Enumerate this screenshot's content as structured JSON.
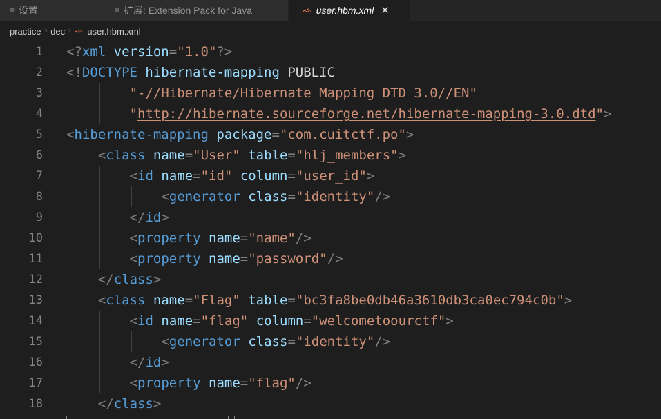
{
  "tabs": [
    {
      "icon": "≡",
      "label": "设置"
    },
    {
      "icon": "≡",
      "label": "扩展: Extension Pack for Java"
    },
    {
      "icon": "⁠ᨒ",
      "label": "user.hbm.xml",
      "close": "✕"
    }
  ],
  "breadcrumb": {
    "parts": [
      "practice",
      "dec",
      "user.hbm.xml"
    ],
    "separator": "›"
  },
  "lines": [
    {
      "n": "1",
      "indent": 0,
      "tokens": [
        [
          "p",
          "<?"
        ],
        [
          "tag",
          "xml"
        ],
        [
          "text",
          " "
        ],
        [
          "attr",
          "version"
        ],
        [
          "p",
          "="
        ],
        [
          "str",
          "\"1.0\""
        ],
        [
          "p",
          "?>"
        ]
      ]
    },
    {
      "n": "2",
      "indent": 0,
      "tokens": [
        [
          "p",
          "<!"
        ],
        [
          "tag",
          "DOCTYPE"
        ],
        [
          "text",
          " "
        ],
        [
          "attr",
          "hibernate-mapping"
        ],
        [
          "text",
          " PUBLIC"
        ]
      ]
    },
    {
      "n": "3",
      "indent": 8,
      "tokens": [
        [
          "str",
          "\"-//Hibernate/Hibernate Mapping DTD 3.0//EN\""
        ]
      ]
    },
    {
      "n": "4",
      "indent": 8,
      "tokens": [
        [
          "str",
          "\""
        ],
        [
          "url",
          "http://hibernate.sourceforge.net/hibernate-mapping-3.0.dtd"
        ],
        [
          "str",
          "\""
        ],
        [
          "p",
          ">"
        ]
      ]
    },
    {
      "n": "5",
      "indent": 0,
      "tokens": [
        [
          "p",
          "<"
        ],
        [
          "tag",
          "hibernate-mapping"
        ],
        [
          "text",
          " "
        ],
        [
          "attr",
          "package"
        ],
        [
          "p",
          "="
        ],
        [
          "str",
          "\"com.cuitctf.po\""
        ],
        [
          "p",
          ">"
        ]
      ]
    },
    {
      "n": "6",
      "indent": 4,
      "tokens": [
        [
          "p",
          "<"
        ],
        [
          "tag",
          "class"
        ],
        [
          "text",
          " "
        ],
        [
          "attr",
          "name"
        ],
        [
          "p",
          "="
        ],
        [
          "str",
          "\"User\""
        ],
        [
          "text",
          " "
        ],
        [
          "attr",
          "table"
        ],
        [
          "p",
          "="
        ],
        [
          "str",
          "\"hlj_members\""
        ],
        [
          "p",
          ">"
        ]
      ]
    },
    {
      "n": "7",
      "indent": 8,
      "tokens": [
        [
          "p",
          "<"
        ],
        [
          "tag",
          "id"
        ],
        [
          "text",
          " "
        ],
        [
          "attr",
          "name"
        ],
        [
          "p",
          "="
        ],
        [
          "str",
          "\"id\""
        ],
        [
          "text",
          " "
        ],
        [
          "attr",
          "column"
        ],
        [
          "p",
          "="
        ],
        [
          "str",
          "\"user_id\""
        ],
        [
          "p",
          ">"
        ]
      ]
    },
    {
      "n": "8",
      "indent": 12,
      "tokens": [
        [
          "p",
          "<"
        ],
        [
          "tag",
          "generator"
        ],
        [
          "text",
          " "
        ],
        [
          "attr",
          "class"
        ],
        [
          "p",
          "="
        ],
        [
          "str",
          "\"identity\""
        ],
        [
          "p",
          "/>"
        ]
      ]
    },
    {
      "n": "9",
      "indent": 8,
      "tokens": [
        [
          "p",
          "</"
        ],
        [
          "tag",
          "id"
        ],
        [
          "p",
          ">"
        ]
      ]
    },
    {
      "n": "10",
      "indent": 8,
      "tokens": [
        [
          "p",
          "<"
        ],
        [
          "tag",
          "property"
        ],
        [
          "text",
          " "
        ],
        [
          "attr",
          "name"
        ],
        [
          "p",
          "="
        ],
        [
          "str",
          "\"name\""
        ],
        [
          "p",
          "/>"
        ]
      ]
    },
    {
      "n": "11",
      "indent": 8,
      "tokens": [
        [
          "p",
          "<"
        ],
        [
          "tag",
          "property"
        ],
        [
          "text",
          " "
        ],
        [
          "attr",
          "name"
        ],
        [
          "p",
          "="
        ],
        [
          "str",
          "\"password\""
        ],
        [
          "p",
          "/>"
        ]
      ]
    },
    {
      "n": "12",
      "indent": 4,
      "tokens": [
        [
          "p",
          "</"
        ],
        [
          "tag",
          "class"
        ],
        [
          "p",
          ">"
        ]
      ]
    },
    {
      "n": "13",
      "indent": 4,
      "tokens": [
        [
          "p",
          "<"
        ],
        [
          "tag",
          "class"
        ],
        [
          "text",
          " "
        ],
        [
          "attr",
          "name"
        ],
        [
          "p",
          "="
        ],
        [
          "str",
          "\"Flag\""
        ],
        [
          "text",
          " "
        ],
        [
          "attr",
          "table"
        ],
        [
          "p",
          "="
        ],
        [
          "str",
          "\"bc3fa8be0db46a3610db3ca0ec794c0b\""
        ],
        [
          "p",
          ">"
        ]
      ]
    },
    {
      "n": "14",
      "indent": 8,
      "tokens": [
        [
          "p",
          "<"
        ],
        [
          "tag",
          "id"
        ],
        [
          "text",
          " "
        ],
        [
          "attr",
          "name"
        ],
        [
          "p",
          "="
        ],
        [
          "str",
          "\"flag\""
        ],
        [
          "text",
          " "
        ],
        [
          "attr",
          "column"
        ],
        [
          "p",
          "="
        ],
        [
          "str",
          "\"welcometoourctf\""
        ],
        [
          "p",
          ">"
        ]
      ]
    },
    {
      "n": "15",
      "indent": 12,
      "tokens": [
        [
          "p",
          "<"
        ],
        [
          "tag",
          "generator"
        ],
        [
          "text",
          " "
        ],
        [
          "attr",
          "class"
        ],
        [
          "p",
          "="
        ],
        [
          "str",
          "\"identity\""
        ],
        [
          "p",
          "/>"
        ]
      ]
    },
    {
      "n": "16",
      "indent": 8,
      "tokens": [
        [
          "p",
          "</"
        ],
        [
          "tag",
          "id"
        ],
        [
          "p",
          ">"
        ]
      ]
    },
    {
      "n": "17",
      "indent": 8,
      "tokens": [
        [
          "p",
          "<"
        ],
        [
          "tag",
          "property"
        ],
        [
          "text",
          " "
        ],
        [
          "attr",
          "name"
        ],
        [
          "p",
          "="
        ],
        [
          "str",
          "\"flag\""
        ],
        [
          "p",
          "/>"
        ]
      ]
    },
    {
      "n": "18",
      "indent": 4,
      "tokens": [
        [
          "p",
          "</"
        ],
        [
          "tag",
          "class"
        ],
        [
          "p",
          ">"
        ]
      ]
    }
  ],
  "colors": {
    "background": "#1e1e1e",
    "tag": "#569cd6",
    "attribute": "#9cdcfe",
    "string": "#ce9178",
    "punctuation": "#808080",
    "line_number": "#858585"
  }
}
